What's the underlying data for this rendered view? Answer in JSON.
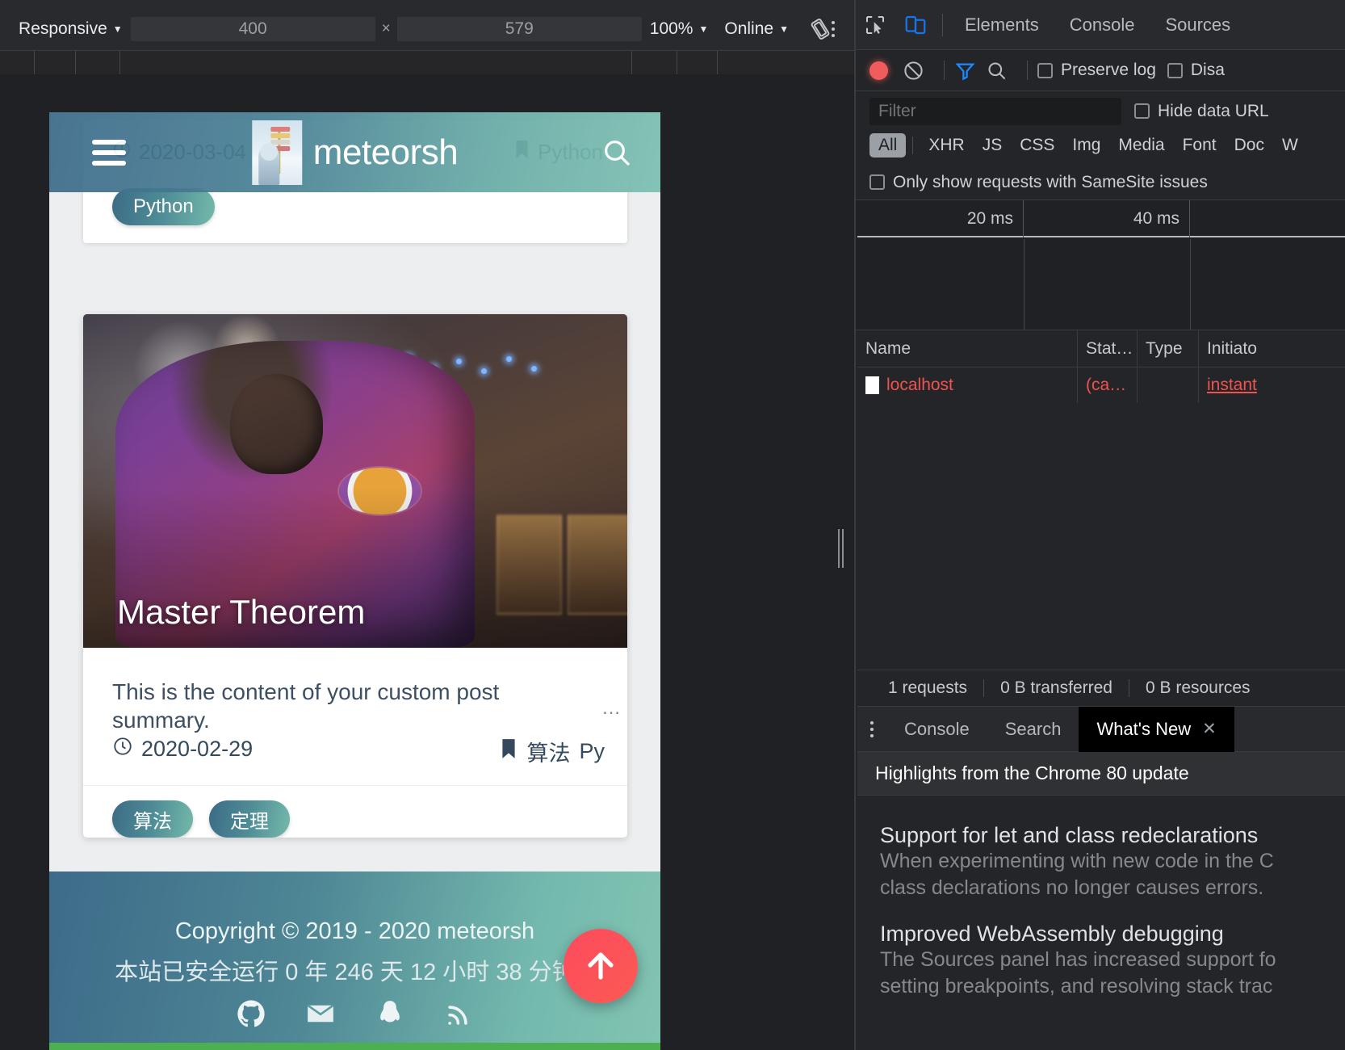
{
  "device_toolbar": {
    "device": "Responsive",
    "device_caret": "▼",
    "width": "400",
    "height": "579",
    "x_sep": "×",
    "zoom": "100%",
    "zoom_caret": "▼",
    "throttling": "Online",
    "throttling_caret": "▼",
    "rotate_icon": "rotate-icon",
    "more_icon": "more-options-icon"
  },
  "site": {
    "brand": "meteorsh",
    "logo_icon": "site-logo-image",
    "menu_icon": "hamburger-menu-icon",
    "search_icon": "search-icon"
  },
  "ghost_post": {
    "clock_icon": "clock-icon",
    "date": "2020-03-04",
    "bookmark_icon": "bookmark-icon",
    "category": "Python",
    "tags": [
      "Python"
    ]
  },
  "post": {
    "title": "Master Theorem",
    "summary": "This is the content of your custom post summary.",
    "summary_ellipsis": "…",
    "clock_icon": "clock-icon",
    "date": "2020-02-29",
    "bookmark_icon": "bookmark-icon",
    "categories": [
      "算法",
      "Py"
    ],
    "tags": [
      "算法",
      "定理"
    ],
    "cover_icon": "post-cover-image"
  },
  "footer": {
    "copyright": "Copyright © 2019 - 2020 meteorsh",
    "uptime": "本站已安全运行 0 年 246 天 12 小时 38 分钟 9",
    "social": [
      {
        "name": "github-icon"
      },
      {
        "name": "email-icon"
      },
      {
        "name": "qq-icon"
      },
      {
        "name": "rss-icon"
      }
    ],
    "back_to_top_icon": "back-to-top-icon"
  },
  "devtools": {
    "inspect_icon": "inspect-element-icon",
    "device_toggle_icon": "toggle-device-toolbar-icon",
    "tabs": [
      "Elements",
      "Console",
      "Sources"
    ],
    "network": {
      "record_icon": "record-button",
      "clear_icon": "clear-icon",
      "filter_icon": "filter-icon",
      "search_icon": "search-icon",
      "preserve_log": "Preserve log",
      "disable_cache": "Disa",
      "filter_placeholder": "Filter",
      "hide_data_urls": "Hide data URL",
      "type_chips": [
        "All",
        "XHR",
        "JS",
        "CSS",
        "Img",
        "Media",
        "Font",
        "Doc",
        "W"
      ],
      "samesite_label": "Only show requests with SameSite issues",
      "overview_ticks": [
        "20 ms",
        "40 ms"
      ],
      "columns": [
        "Name",
        "Stat…",
        "Type",
        "Initiato"
      ],
      "rows": [
        {
          "icon": "document-icon",
          "name": "localhost",
          "status": "(ca…",
          "type": "",
          "initiator": "instant"
        }
      ],
      "status": [
        "1 requests",
        "0 B transferred",
        "0 B resources"
      ]
    },
    "drawer": {
      "more_icon": "drawer-more-icon",
      "tabs": [
        "Console",
        "Search"
      ],
      "active_tab": "What's New",
      "close_icon": "close-icon",
      "whats_new_header": "Highlights from the Chrome 80 update",
      "items": [
        {
          "title": "Support for let and class redeclarations",
          "desc_line1": "When experimenting with new code in the C",
          "desc_line2": "class declarations no longer causes errors."
        },
        {
          "title": "Improved WebAssembly debugging",
          "desc_line1": "The Sources panel has increased support fo",
          "desc_line2": "setting breakpoints, and resolving stack trac"
        }
      ]
    }
  }
}
